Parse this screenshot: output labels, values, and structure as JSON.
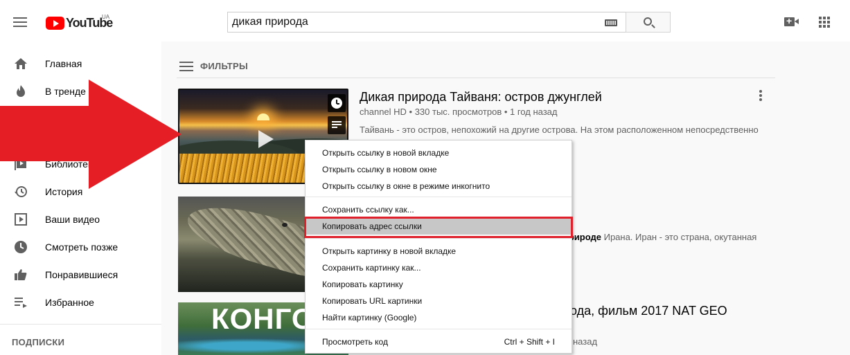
{
  "header": {
    "logo_text": "YouTube",
    "country_code": "UA",
    "search_value": "дикая природа"
  },
  "sidebar": {
    "items": [
      {
        "label": "Главная",
        "icon": "home-icon"
      },
      {
        "label": "В тренде",
        "icon": "flame-icon"
      },
      {
        "label": "Библиотека",
        "icon": "library-icon"
      },
      {
        "label": "История",
        "icon": "history-icon"
      },
      {
        "label": "Ваши видео",
        "icon": "play-square-icon"
      },
      {
        "label": "Смотреть позже",
        "icon": "clock-icon"
      },
      {
        "label": "Понравившиеся",
        "icon": "thumbs-up-icon"
      },
      {
        "label": "Избранное",
        "icon": "playlist-icon"
      }
    ],
    "section_title": "ПОДПИСКИ"
  },
  "filters": {
    "label": "ФИЛЬТРЫ"
  },
  "videos": [
    {
      "title": "Дикая природа Тайваня: остров джунглей",
      "meta": "channel HD • 330 тыс. просмотров • 1 год назад",
      "description": "Тайвань - это остров, непохожий на другие острова. На этом расположенном непосредственно"
    },
    {
      "title_fragment": "",
      "desc_bold": "природе",
      "desc_rest": " Ирана. Иран - это страна, окутанная"
    },
    {
      "thumb_text": "КОНГО",
      "title_fragment": "ода, фильм 2017 NAT GEO",
      "meta_fragment": "назад"
    }
  ],
  "context_menu": {
    "items": [
      {
        "label": "Открыть ссылку в новой вкладке"
      },
      {
        "label": "Открыть ссылку в новом окне"
      },
      {
        "label": "Открыть ссылку в окне в режиме инкогнито"
      },
      {
        "label": "Сохранить ссылку как..."
      },
      {
        "label": "Копировать адрес ссылки",
        "highlighted": true
      },
      {
        "label": "Открыть картинку в новой вкладке"
      },
      {
        "label": "Сохранить картинку как..."
      },
      {
        "label": "Копировать картинку"
      },
      {
        "label": "Копировать URL картинки"
      },
      {
        "label": "Найти картинку (Google)"
      },
      {
        "label": "Просмотреть код",
        "shortcut": "Ctrl + Shift + I"
      }
    ]
  },
  "colors": {
    "brand_red": "#ff0000",
    "highlight_box": "#e0202a",
    "annotation_arrow": "#e51e25"
  }
}
